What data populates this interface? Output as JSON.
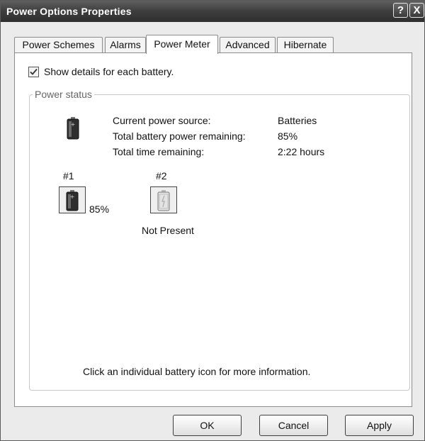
{
  "window": {
    "title": "Power Options Properties",
    "help_label": "?",
    "close_label": "X"
  },
  "tabs": [
    {
      "label": "Power Schemes",
      "active": false
    },
    {
      "label": "Alarms",
      "active": false
    },
    {
      "label": "Power Meter",
      "active": true
    },
    {
      "label": "Advanced",
      "active": false
    },
    {
      "label": "Hibernate",
      "active": false
    }
  ],
  "options": {
    "show_details_label": "Show details for each battery.",
    "show_details_checked": true
  },
  "power_status": {
    "legend": "Power status",
    "source_icon": "battery-icon",
    "rows": [
      {
        "label": "Current power source:",
        "value": "Batteries"
      },
      {
        "label": "Total battery power remaining:",
        "value": "85%"
      },
      {
        "label": "Total time remaining:",
        "value": "2:22 hours"
      }
    ]
  },
  "batteries": [
    {
      "number": "#1",
      "status": "85%",
      "icon": "battery-icon",
      "present": true
    },
    {
      "number": "#2",
      "status": "Not Present",
      "icon": "battery-empty-icon",
      "present": false
    }
  ],
  "hint": "Click an individual battery icon for more information.",
  "buttons": {
    "ok": "OK",
    "cancel": "Cancel",
    "apply": "Apply"
  }
}
